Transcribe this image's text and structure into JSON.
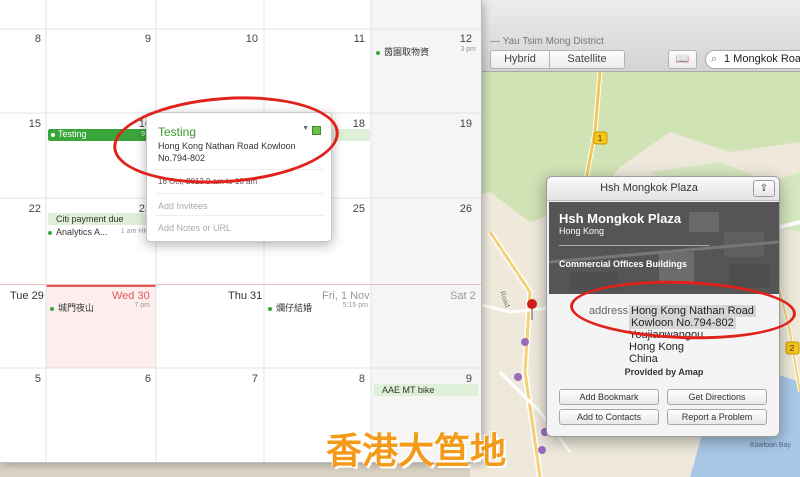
{
  "map": {
    "title": "— Yau Tsim Mong District",
    "modes": [
      "Hybrid",
      "Satellite"
    ],
    "bookmarks_icon": "📖",
    "search_value": "1 Mongkok Road,",
    "road_badge": "1",
    "road_badge2": "2",
    "label_bay": "Kowloon Bay",
    "label_road": "Road"
  },
  "place": {
    "header": "Hsh Mongkok Plaza",
    "name": "Hsh Mongkok Plaza",
    "city": "Hong Kong",
    "category": "Commercial Offices Buildings",
    "address_label": "address",
    "address_lines": [
      "Hong Kong Nathan Road",
      "Kowloon No.794-802",
      "Youjianwangou",
      "Hong Kong",
      "China"
    ],
    "provided_by": "Provided by Amap",
    "buttons": {
      "bookmark": "Add Bookmark",
      "directions": "Get Directions",
      "contacts": "Add to Contacts",
      "problem": "Report a Problem"
    }
  },
  "calendar": {
    "row1_days": [
      "8",
      "9",
      "10",
      "11",
      "12"
    ],
    "row2_days": [
      "15",
      "16",
      "17",
      "18",
      "19"
    ],
    "row3_days": [
      "22",
      "23",
      "24",
      "25",
      "26"
    ],
    "row4_daynames": [
      "Tue 29",
      "Wed 30",
      "Thu 31",
      "Fri, 1 Nov",
      "Sat 2"
    ],
    "row5_days": [
      "5",
      "6",
      "7",
      "8",
      "9"
    ],
    "events": {
      "e12": {
        "title": "茵園取物資",
        "time": "3 pm"
      },
      "testing": {
        "title": "Testing",
        "time": "9"
      },
      "citi": {
        "title": "Citi payment due"
      },
      "analytics": {
        "title": "Analytics A...",
        "time": "1 am HK"
      },
      "e30": {
        "title": "城門夜山",
        "time": "7 pm"
      },
      "e1nov": {
        "title": "爛仔結婚",
        "time": "5:15 pm"
      },
      "aae": {
        "title": "AAE MT bike"
      }
    }
  },
  "event_popover": {
    "title": "Testing",
    "location_line1": "Hong Kong Nathan Road  Kowloon",
    "location_line2": "No.794-802",
    "date": "16 Oct, 2013  9 am to 10 am",
    "invitees_placeholder": "Add Invitees",
    "notes_placeholder": "Add Notes or URL"
  },
  "watermark": "香港大笪地",
  "colors": {
    "event_green": "#3aa53a",
    "annotation_red": "#e0221a",
    "today_red": "#e05a5a",
    "watermark_orange": "#f39a18"
  }
}
